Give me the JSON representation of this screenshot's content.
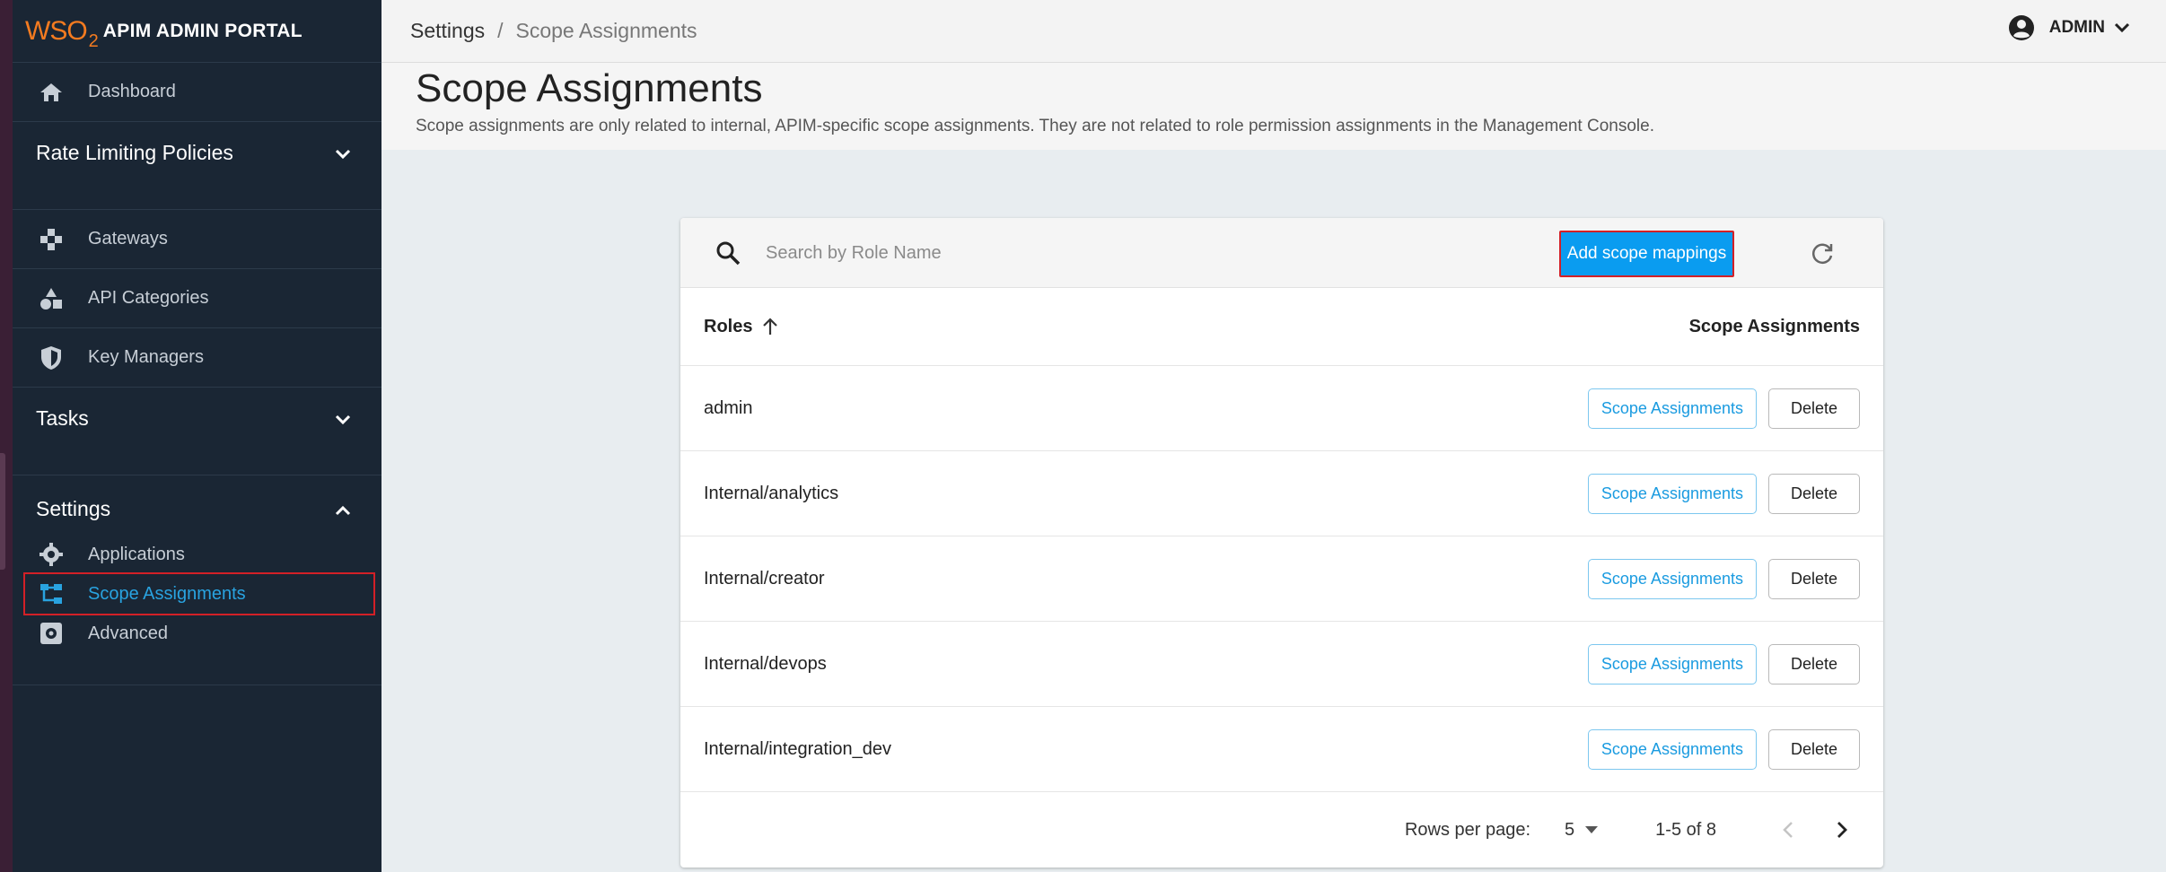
{
  "brand": {
    "logo_main": "WSO",
    "logo_sub": "2",
    "portal_name": "APIM ADMIN PORTAL"
  },
  "sidebar": {
    "dashboard": {
      "label": "Dashboard",
      "icon": "home-icon"
    },
    "rate_limiting": {
      "label": "Rate Limiting Policies",
      "icon": "chevron-down-icon"
    },
    "gateways": {
      "label": "Gateways",
      "icon": "gateway-icon"
    },
    "api_categories": {
      "label": "API Categories",
      "icon": "categories-icon"
    },
    "key_managers": {
      "label": "Key Managers",
      "icon": "shield-icon"
    },
    "tasks": {
      "label": "Tasks",
      "icon": "chevron-down-icon"
    },
    "settings": {
      "label": "Settings",
      "icon": "chevron-up-icon",
      "items": [
        {
          "label": "Applications",
          "icon": "gear-icon"
        },
        {
          "label": "Scope Assignments",
          "icon": "tree-icon",
          "active": true
        },
        {
          "label": "Advanced",
          "icon": "settings-box-icon"
        }
      ]
    }
  },
  "topbar": {
    "breadcrumb": [
      "Settings",
      "Scope Assignments"
    ],
    "separator": "/",
    "user": "ADMIN"
  },
  "page": {
    "title": "Scope Assignments",
    "description": "Scope assignments are only related to internal, APIM-specific scope assignments. They are not related to role permission assignments in the Management Console."
  },
  "table": {
    "search_placeholder": "Search by Role Name",
    "add_button": "Add scope mappings",
    "col_roles": "Roles",
    "col_scope": "Scope Assignments",
    "rows": [
      {
        "role": "admin"
      },
      {
        "role": "Internal/analytics"
      },
      {
        "role": "Internal/creator"
      },
      {
        "role": "Internal/devops"
      },
      {
        "role": "Internal/integration_dev"
      }
    ],
    "row_scope_btn": "Scope Assignments",
    "row_delete_btn": "Delete",
    "rows_per_page_label": "Rows per page:",
    "rows_per_page": "5",
    "range": "1-5 of 8"
  },
  "colors": {
    "accent": "#0a9cf0",
    "sidebar_bg": "#1a2634",
    "active_link": "#29a3e0",
    "highlight": "#d32027"
  }
}
